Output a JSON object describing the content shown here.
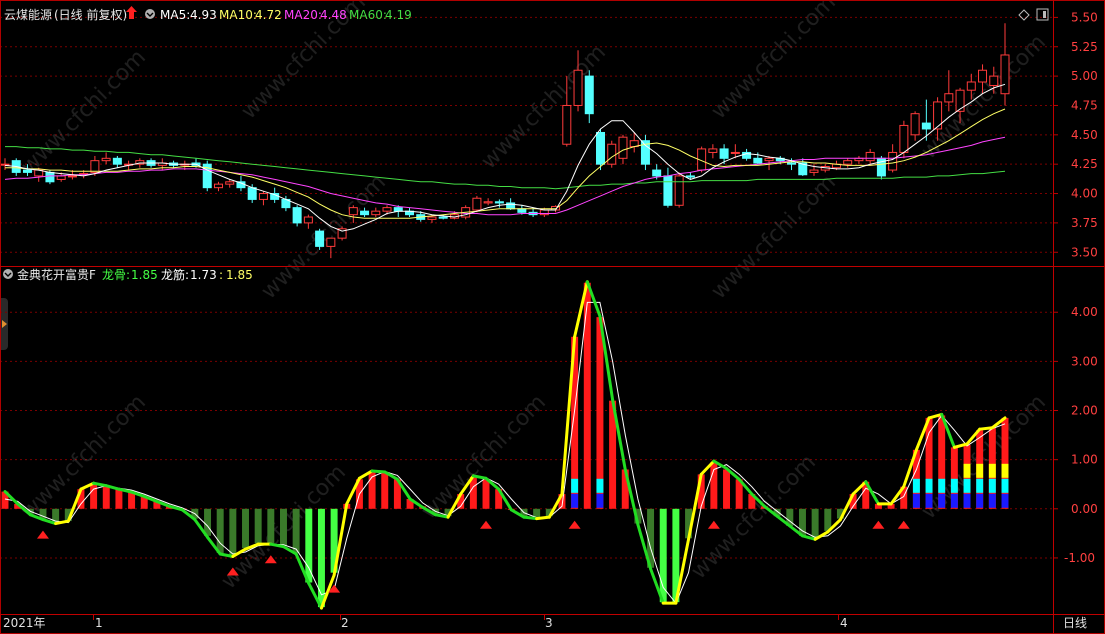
{
  "stock": {
    "name": "云煤能源",
    "period_note": "(日线 前复权)",
    "ma5_label": "MA5:",
    "ma5_value": "4.93",
    "ma10_label": "MA10:",
    "ma10_value": "4.72",
    "ma20_label": "MA20:",
    "ma20_value": "4.48",
    "ma60_label": "MA60:",
    "ma60_value": "4.19"
  },
  "indicator": {
    "name": "金典花开富贵F",
    "line1_label": "龙骨:",
    "line1_value": "1.85",
    "line2_label": "龙筋:",
    "line2_value": "1.73",
    "line3_label": ":",
    "line3_value": "1.85"
  },
  "footer": {
    "year_label": "2021年",
    "months": [
      "1",
      "2",
      "3",
      "4"
    ],
    "period_button": "日线"
  },
  "watermark": "www.cfchi.com",
  "colors": {
    "up": "#ff3b3b",
    "down": "#54ffff",
    "ma5": "#ffffff",
    "ma10": "#ffff66",
    "ma20": "#ff44ff",
    "ma60": "#44dd44",
    "bull_bar": "#ff1a1a",
    "bear_bar": "#3a7a2a",
    "bottom_bar": "#44ff44",
    "yellow": "#ffff00",
    "cyan": "#00ffff",
    "blue": "#1a1aff",
    "grid": "#7a0000"
  },
  "chart_data": [
    {
      "type": "candlestick",
      "title": "云煤能源",
      "y_ticks": [
        "3.50",
        "3.75",
        "4.00",
        "4.25",
        "4.50",
        "4.75",
        "5.00",
        "5.25",
        "5.50"
      ],
      "ylim": [
        3.4,
        5.58
      ],
      "grid": true,
      "candles": [
        [
          4.25,
          4.3,
          4.2,
          4.25
        ],
        [
          4.28,
          4.3,
          4.15,
          4.18
        ],
        [
          4.2,
          4.25,
          4.15,
          4.18
        ],
        [
          4.15,
          4.22,
          4.1,
          4.2
        ],
        [
          4.18,
          4.2,
          4.08,
          4.1
        ],
        [
          4.12,
          4.18,
          4.1,
          4.15
        ],
        [
          4.15,
          4.2,
          4.12,
          4.15
        ],
        [
          4.16,
          4.2,
          4.13,
          4.17
        ],
        [
          4.18,
          4.32,
          4.15,
          4.28
        ],
        [
          4.28,
          4.35,
          4.25,
          4.3
        ],
        [
          4.3,
          4.32,
          4.22,
          4.25
        ],
        [
          4.25,
          4.28,
          4.2,
          4.25
        ],
        [
          4.25,
          4.3,
          4.22,
          4.28
        ],
        [
          4.28,
          4.3,
          4.22,
          4.24
        ],
        [
          4.24,
          4.3,
          4.2,
          4.26
        ],
        [
          4.26,
          4.28,
          4.22,
          4.24
        ],
        [
          4.25,
          4.28,
          4.2,
          4.25
        ],
        [
          4.26,
          4.3,
          4.22,
          4.24
        ],
        [
          4.25,
          4.28,
          4.02,
          4.05
        ],
        [
          4.05,
          4.1,
          4.02,
          4.08
        ],
        [
          4.08,
          4.12,
          4.05,
          4.1
        ],
        [
          4.1,
          4.15,
          4.02,
          4.05
        ],
        [
          4.05,
          4.08,
          3.92,
          3.95
        ],
        [
          3.95,
          4.02,
          3.9,
          4.0
        ],
        [
          4.0,
          4.05,
          3.92,
          3.95
        ],
        [
          3.95,
          3.98,
          3.85,
          3.88
        ],
        [
          3.88,
          3.9,
          3.72,
          3.75
        ],
        [
          3.75,
          3.82,
          3.7,
          3.8
        ],
        [
          3.68,
          3.7,
          3.52,
          3.55
        ],
        [
          3.55,
          3.62,
          3.45,
          3.62
        ],
        [
          3.62,
          3.72,
          3.6,
          3.7
        ],
        [
          3.82,
          3.9,
          3.75,
          3.88
        ],
        [
          3.85,
          3.88,
          3.8,
          3.82
        ],
        [
          3.82,
          3.88,
          3.8,
          3.85
        ],
        [
          3.85,
          3.9,
          3.82,
          3.88
        ],
        [
          3.88,
          3.9,
          3.8,
          3.85
        ],
        [
          3.85,
          3.88,
          3.8,
          3.82
        ],
        [
          3.82,
          3.85,
          3.76,
          3.78
        ],
        [
          3.78,
          3.82,
          3.75,
          3.8
        ],
        [
          3.8,
          3.82,
          3.78,
          3.79
        ],
        [
          3.79,
          3.85,
          3.78,
          3.82
        ],
        [
          3.8,
          3.9,
          3.78,
          3.88
        ],
        [
          3.86,
          3.98,
          3.84,
          3.96
        ],
        [
          3.92,
          3.96,
          3.9,
          3.93
        ],
        [
          3.93,
          3.95,
          3.88,
          3.92
        ],
        [
          3.92,
          3.96,
          3.86,
          3.87
        ],
        [
          3.87,
          3.9,
          3.82,
          3.84
        ],
        [
          3.84,
          3.88,
          3.8,
          3.82
        ],
        [
          3.82,
          3.88,
          3.8,
          3.86
        ],
        [
          3.86,
          3.9,
          3.84,
          3.89
        ],
        [
          4.42,
          5.0,
          4.4,
          4.75
        ],
        [
          4.75,
          5.22,
          4.7,
          5.05
        ],
        [
          5.0,
          5.05,
          4.6,
          4.68
        ],
        [
          4.52,
          4.55,
          4.2,
          4.25
        ],
        [
          4.25,
          4.45,
          4.22,
          4.42
        ],
        [
          4.3,
          4.5,
          4.25,
          4.48
        ],
        [
          4.4,
          4.52,
          4.35,
          4.45
        ],
        [
          4.45,
          4.5,
          4.2,
          4.25
        ],
        [
          4.2,
          4.25,
          4.12,
          4.15
        ],
        [
          4.15,
          4.22,
          3.88,
          3.9
        ],
        [
          3.9,
          4.18,
          3.88,
          4.15
        ],
        [
          4.15,
          4.18,
          4.12,
          4.14
        ],
        [
          4.2,
          4.4,
          4.18,
          4.38
        ],
        [
          4.35,
          4.42,
          4.3,
          4.38
        ],
        [
          4.38,
          4.42,
          4.25,
          4.3
        ],
        [
          4.35,
          4.42,
          4.3,
          4.35
        ],
        [
          4.35,
          4.38,
          4.28,
          4.3
        ],
        [
          4.3,
          4.35,
          4.25,
          4.26
        ],
        [
          4.28,
          4.32,
          4.2,
          4.3
        ],
        [
          4.3,
          4.32,
          4.25,
          4.28
        ],
        [
          4.26,
          4.3,
          4.2,
          4.25
        ],
        [
          4.26,
          4.3,
          4.15,
          4.16
        ],
        [
          4.18,
          4.25,
          4.15,
          4.2
        ],
        [
          4.2,
          4.25,
          4.18,
          4.23
        ],
        [
          4.22,
          4.28,
          4.2,
          4.25
        ],
        [
          4.25,
          4.3,
          4.22,
          4.28
        ],
        [
          4.28,
          4.32,
          4.25,
          4.3
        ],
        [
          4.28,
          4.38,
          4.25,
          4.35
        ],
        [
          4.3,
          4.32,
          4.12,
          4.15
        ],
        [
          4.2,
          4.42,
          4.18,
          4.35
        ],
        [
          4.35,
          4.62,
          4.3,
          4.58
        ],
        [
          4.5,
          4.7,
          4.45,
          4.68
        ],
        [
          4.6,
          4.8,
          4.45,
          4.55
        ],
        [
          4.55,
          4.82,
          4.45,
          4.78
        ],
        [
          4.78,
          5.05,
          4.7,
          4.85
        ],
        [
          4.7,
          4.9,
          4.6,
          4.88
        ],
        [
          4.88,
          5.02,
          4.8,
          4.95
        ],
        [
          4.95,
          5.1,
          4.85,
          5.05
        ],
        [
          4.92,
          5.08,
          4.85,
          5.0
        ],
        [
          4.85,
          5.45,
          4.75,
          5.18
        ]
      ],
      "ma5": [
        4.24,
        4.23,
        4.21,
        4.2,
        4.18,
        4.17,
        4.16,
        4.15,
        4.17,
        4.2,
        4.22,
        4.24,
        4.26,
        4.26,
        4.26,
        4.25,
        4.25,
        4.25,
        4.2,
        4.16,
        4.12,
        4.09,
        4.05,
        4.02,
        3.99,
        3.95,
        3.91,
        3.87,
        3.79,
        3.72,
        3.68,
        3.7,
        3.74,
        3.78,
        3.83,
        3.85,
        3.85,
        3.84,
        3.82,
        3.81,
        3.8,
        3.82,
        3.85,
        3.88,
        3.9,
        3.91,
        3.9,
        3.88,
        3.86,
        3.86,
        4.02,
        4.24,
        4.42,
        4.55,
        4.62,
        4.62,
        4.52,
        4.41,
        4.34,
        4.25,
        4.17,
        4.12,
        4.15,
        4.22,
        4.27,
        4.31,
        4.34,
        4.33,
        4.31,
        4.3,
        4.28,
        4.25,
        4.23,
        4.22,
        4.21,
        4.21,
        4.22,
        4.25,
        4.27,
        4.29,
        4.35,
        4.42,
        4.49,
        4.57,
        4.65,
        4.72,
        4.78,
        4.85,
        4.9,
        4.93
      ],
      "ma10": [
        4.22,
        4.22,
        4.21,
        4.21,
        4.2,
        4.2,
        4.19,
        4.19,
        4.19,
        4.19,
        4.19,
        4.2,
        4.21,
        4.21,
        4.22,
        4.22,
        4.23,
        4.23,
        4.22,
        4.2,
        4.18,
        4.16,
        4.14,
        4.11,
        4.08,
        4.05,
        4.01,
        3.97,
        3.91,
        3.86,
        3.82,
        3.8,
        3.79,
        3.79,
        3.79,
        3.79,
        3.79,
        3.8,
        3.81,
        3.82,
        3.83,
        3.84,
        3.85,
        3.86,
        3.87,
        3.87,
        3.87,
        3.87,
        3.87,
        3.87,
        3.94,
        4.05,
        4.15,
        4.23,
        4.31,
        4.37,
        4.4,
        4.42,
        4.43,
        4.41,
        4.37,
        4.32,
        4.28,
        4.24,
        4.23,
        4.24,
        4.24,
        4.24,
        4.25,
        4.26,
        4.27,
        4.27,
        4.26,
        4.26,
        4.25,
        4.24,
        4.24,
        4.24,
        4.25,
        4.26,
        4.28,
        4.31,
        4.35,
        4.4,
        4.45,
        4.51,
        4.57,
        4.63,
        4.68,
        4.72
      ],
      "ma20": [
        4.12,
        4.13,
        4.13,
        4.14,
        4.15,
        4.15,
        4.16,
        4.16,
        4.17,
        4.18,
        4.18,
        4.19,
        4.19,
        4.2,
        4.2,
        4.21,
        4.21,
        4.21,
        4.2,
        4.19,
        4.18,
        4.17,
        4.16,
        4.14,
        4.12,
        4.1,
        4.08,
        4.06,
        4.03,
        4.0,
        3.98,
        3.96,
        3.94,
        3.92,
        3.91,
        3.89,
        3.88,
        3.87,
        3.86,
        3.85,
        3.84,
        3.83,
        3.83,
        3.82,
        3.82,
        3.82,
        3.83,
        3.83,
        3.83,
        3.83,
        3.86,
        3.9,
        3.94,
        3.98,
        4.02,
        4.06,
        4.09,
        4.12,
        4.14,
        4.15,
        4.17,
        4.18,
        4.2,
        4.21,
        4.22,
        4.23,
        4.24,
        4.25,
        4.26,
        4.27,
        4.28,
        4.29,
        4.29,
        4.3,
        4.3,
        4.3,
        4.3,
        4.3,
        4.3,
        4.3,
        4.31,
        4.32,
        4.33,
        4.35,
        4.37,
        4.39,
        4.41,
        4.44,
        4.46,
        4.48
      ],
      "ma60": [
        4.4,
        4.4,
        4.39,
        4.39,
        4.38,
        4.38,
        4.37,
        4.37,
        4.36,
        4.36,
        4.35,
        4.35,
        4.34,
        4.33,
        4.33,
        4.32,
        4.31,
        4.3,
        4.29,
        4.28,
        4.27,
        4.26,
        4.25,
        4.24,
        4.23,
        4.22,
        4.21,
        4.2,
        4.19,
        4.18,
        4.17,
        4.16,
        4.15,
        4.14,
        4.13,
        4.12,
        4.11,
        4.1,
        4.1,
        4.09,
        4.08,
        4.08,
        4.07,
        4.07,
        4.06,
        4.06,
        4.05,
        4.05,
        4.05,
        4.04,
        4.05,
        4.06,
        4.07,
        4.07,
        4.08,
        4.08,
        4.09,
        4.09,
        4.1,
        4.1,
        4.1,
        4.1,
        4.11,
        4.11,
        4.11,
        4.11,
        4.11,
        4.12,
        4.12,
        4.12,
        4.12,
        4.12,
        4.12,
        4.12,
        4.13,
        4.13,
        4.13,
        4.13,
        4.13,
        4.13,
        4.14,
        4.14,
        4.14,
        4.15,
        4.15,
        4.16,
        4.17,
        4.17,
        4.18,
        4.19
      ]
    },
    {
      "type": "bar",
      "title": "金典花开富贵F",
      "y_ticks": [
        "-1.00",
        "0.00",
        "1.00",
        "2.00",
        "3.00",
        "4.00"
      ],
      "ylim": [
        -2.1,
        4.9
      ],
      "grid": true,
      "values": [
        0.35,
        0.1,
        -0.1,
        -0.2,
        -0.3,
        -0.25,
        0.4,
        0.5,
        0.45,
        0.4,
        0.35,
        0.25,
        0.15,
        0.05,
        0.0,
        -0.2,
        -0.55,
        -0.9,
        -0.95,
        -0.8,
        -0.7,
        -0.7,
        -0.75,
        -0.9,
        -1.5,
        -2.0,
        -1.3,
        0.1,
        0.6,
        0.75,
        0.75,
        0.6,
        0.2,
        0.05,
        -0.1,
        -0.15,
        0.3,
        0.65,
        0.6,
        0.4,
        0.0,
        -0.15,
        -0.18,
        -0.15,
        0.3,
        3.5,
        4.6,
        3.9,
        2.2,
        0.8,
        -0.3,
        -1.2,
        -1.9,
        -1.9,
        -0.6,
        0.7,
        0.95,
        0.8,
        0.6,
        0.3,
        0.05,
        -0.15,
        -0.35,
        -0.55,
        -0.6,
        -0.45,
        -0.2,
        0.3,
        0.55,
        0.1,
        0.1,
        0.45,
        1.2,
        1.85,
        1.9,
        1.25,
        1.3,
        1.6,
        1.65,
        1.85
      ],
      "line1": [
        0.35,
        0.1,
        -0.12,
        -0.22,
        -0.3,
        -0.25,
        0.4,
        0.52,
        0.47,
        0.4,
        0.34,
        0.25,
        0.15,
        0.05,
        -0.02,
        -0.22,
        -0.58,
        -0.92,
        -0.97,
        -0.82,
        -0.72,
        -0.72,
        -0.77,
        -0.92,
        -1.52,
        -2.02,
        -1.35,
        0.1,
        0.62,
        0.77,
        0.75,
        0.6,
        0.2,
        0.03,
        -0.12,
        -0.17,
        0.3,
        0.67,
        0.62,
        0.4,
        -0.02,
        -0.17,
        -0.2,
        -0.17,
        0.3,
        3.5,
        4.62,
        3.92,
        2.22,
        0.8,
        -0.32,
        -1.22,
        -1.92,
        -1.92,
        -0.62,
        0.7,
        0.97,
        0.82,
        0.6,
        0.3,
        0.05,
        -0.15,
        -0.35,
        -0.55,
        -0.62,
        -0.47,
        -0.22,
        0.3,
        0.55,
        0.1,
        0.1,
        0.45,
        1.2,
        1.85,
        1.92,
        1.25,
        1.32,
        1.62,
        1.65,
        1.85
      ],
      "line2": [
        0.2,
        0.15,
        -0.05,
        -0.15,
        -0.25,
        -0.28,
        0.1,
        0.4,
        0.47,
        0.42,
        0.38,
        0.3,
        0.2,
        0.1,
        0.02,
        -0.1,
        -0.35,
        -0.7,
        -0.92,
        -0.88,
        -0.75,
        -0.72,
        -0.73,
        -0.82,
        -1.2,
        -1.75,
        -1.65,
        -0.6,
        0.3,
        0.65,
        0.76,
        0.68,
        0.4,
        0.12,
        -0.05,
        -0.14,
        0.05,
        0.45,
        0.63,
        0.5,
        0.2,
        -0.08,
        -0.18,
        -0.17,
        0.05,
        2.0,
        4.2,
        4.2,
        3.0,
        1.5,
        0.2,
        -0.8,
        -1.6,
        -1.92,
        -1.3,
        0.05,
        0.8,
        0.9,
        0.7,
        0.45,
        0.15,
        -0.05,
        -0.25,
        -0.45,
        -0.58,
        -0.55,
        -0.35,
        0.05,
        0.42,
        0.3,
        0.1,
        0.25,
        0.8,
        1.55,
        1.9,
        1.6,
        1.28,
        1.45,
        1.63,
        1.73
      ]
    }
  ]
}
